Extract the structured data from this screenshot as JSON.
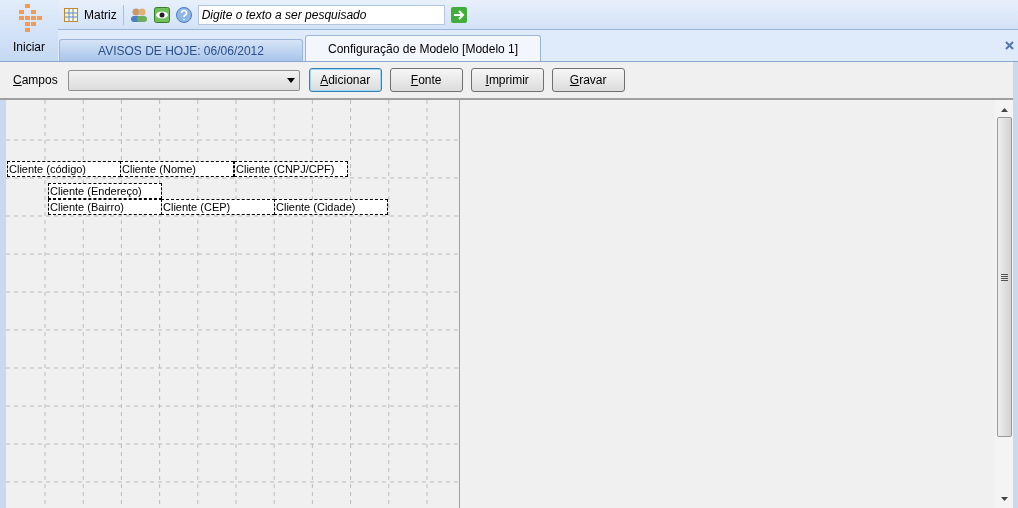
{
  "start_button": {
    "label": "Iniciar"
  },
  "quick_toolbar": {
    "matriz_label": "Matriz",
    "search": {
      "placeholder": "Digite o texto a ser pesquisado"
    }
  },
  "tabs": [
    {
      "label": "AVISOS DE HOJE: 06/06/2012",
      "selected": false
    },
    {
      "label": "Configuração de Modelo [Modelo 1]",
      "selected": true
    }
  ],
  "toolbar": {
    "campos_label": "Campos",
    "buttons": [
      {
        "label": "Adicionar",
        "focused": true
      },
      {
        "label": "Fonte",
        "focused": false
      },
      {
        "label": "Imprimir",
        "focused": false
      },
      {
        "label": "Gravar",
        "focused": false
      }
    ]
  },
  "canvas_fields": [
    {
      "label": "Cliente (código)"
    },
    {
      "label": "Cliente (Nome)"
    },
    {
      "label": "Cliente (CNPJ/CPF)"
    },
    {
      "label": "Cliente (Endereço)"
    },
    {
      "label": "Cliente (Bairro)"
    },
    {
      "label": "Cliente (CEP)"
    },
    {
      "label": "Cliente (Cidade)"
    }
  ]
}
